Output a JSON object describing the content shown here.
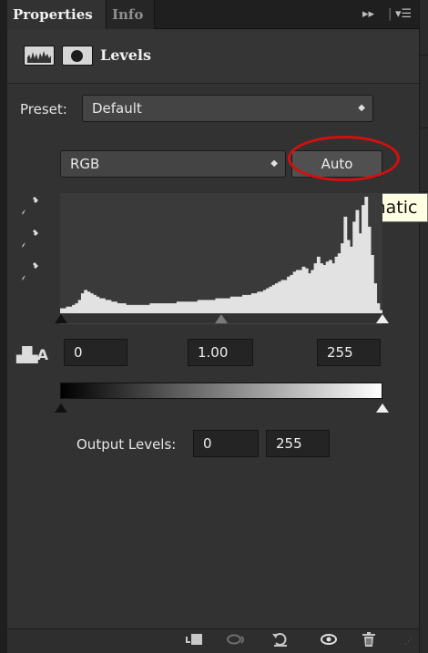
{
  "tabs": [
    {
      "label": "Properties",
      "active": true
    },
    {
      "label": "Info",
      "active": false
    }
  ],
  "panel_controls": {
    "collapse": "▸▸",
    "menu": "▾☰"
  },
  "header": {
    "title": "Levels",
    "adjustment_icon": "levels-histogram-icon",
    "mask_icon": "layer-mask-icon"
  },
  "preset": {
    "label": "Preset:",
    "value": "Default"
  },
  "channel": {
    "value": "RGB"
  },
  "auto_button": {
    "label": "Auto"
  },
  "tooltip": {
    "text": "Automatic"
  },
  "input_levels": {
    "black": "0",
    "gamma": "1.00",
    "white": "255"
  },
  "output": {
    "label": "Output Levels:",
    "black": "0",
    "white": "255"
  },
  "histogram": [
    3,
    3,
    4,
    4,
    5,
    6,
    8,
    12,
    14,
    13,
    12,
    11,
    10,
    9,
    9,
    8,
    8,
    7,
    7,
    6,
    6,
    6,
    5,
    5,
    5,
    5,
    5,
    5,
    5,
    5,
    6,
    6,
    6,
    6,
    6,
    6,
    6,
    6,
    6,
    7,
    7,
    7,
    7,
    7,
    7,
    7,
    8,
    8,
    8,
    8,
    8,
    8,
    9,
    9,
    9,
    9,
    9,
    10,
    10,
    10,
    10,
    11,
    11,
    11,
    12,
    12,
    13,
    13,
    14,
    15,
    16,
    17,
    18,
    19,
    20,
    20,
    22,
    23,
    25,
    26,
    26,
    28,
    27,
    24,
    26,
    30,
    34,
    30,
    29,
    31,
    32,
    30,
    34,
    36,
    42,
    58,
    44,
    40,
    55,
    62,
    48,
    65,
    70,
    52,
    35,
    18,
    6,
    2
  ],
  "colors": {
    "panel_bg": "#323232",
    "tab_bar_bg": "#1f1f1f",
    "field_bg": "#242424",
    "annotation_red": "#d40f0f",
    "tooltip_bg": "#ffffe1"
  },
  "footer_icons": [
    "clip-to-layer-icon",
    "view-previous-state-icon",
    "reset-icon",
    "visibility-eye-icon",
    "trash-icon"
  ]
}
